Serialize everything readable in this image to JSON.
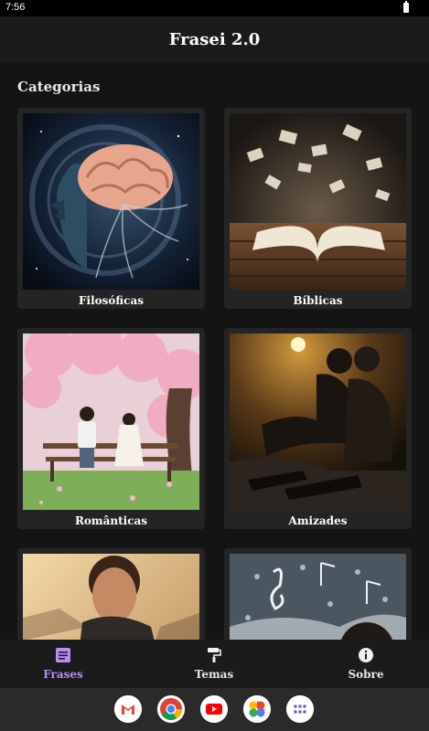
{
  "status": {
    "time": "7:56"
  },
  "app": {
    "title": "Frasei 2.0"
  },
  "section": {
    "title": "Categorias"
  },
  "categories": [
    {
      "label": "Filosóficas"
    },
    {
      "label": "Bíblicas"
    },
    {
      "label": "Românticas"
    },
    {
      "label": "Amizades"
    },
    {
      "label": ""
    },
    {
      "label": ""
    }
  ],
  "nav": {
    "items": [
      {
        "label": "Frases",
        "icon": "quote-card-icon",
        "active": true
      },
      {
        "label": "Temas",
        "icon": "paint-roller-icon",
        "active": false
      },
      {
        "label": "Sobre",
        "icon": "info-icon",
        "active": false
      }
    ],
    "active_color": "#b98cf5"
  },
  "dock": {
    "apps": [
      "gmail-icon",
      "chrome-icon",
      "youtube-icon",
      "photos-icon",
      "app-drawer-icon"
    ]
  }
}
